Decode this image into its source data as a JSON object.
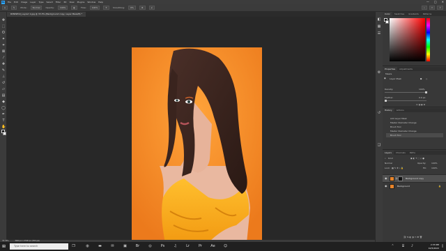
{
  "app": {
    "logo": "Ps",
    "menus": [
      "File",
      "Edit",
      "Image",
      "Layer",
      "Type",
      "Select",
      "Filter",
      "3D",
      "View",
      "Plugins",
      "Window",
      "Help"
    ],
    "window_controls": [
      "—",
      "□",
      "✕"
    ]
  },
  "options": {
    "mode_label": "Mode:",
    "mode_value": "Normal",
    "opacity_label": "Opacity:",
    "opacity_value": "100%",
    "flow_label": "Flow:",
    "flow_value": "100%",
    "smoothing_label": "Smoothing:",
    "smoothing_value": "0%"
  },
  "document": {
    "tab_title": "RVNWP10_Layout 1.jpg @ 33.3% (Background copy, Layer Mask/8) *"
  },
  "status": {
    "zoom": "33.33%",
    "doc_size": "3000 px x 4500 px (300 ppi)"
  },
  "color_panel": {
    "tabs": [
      "Color",
      "Swatches",
      "Gradients",
      "Patterns"
    ]
  },
  "properties_panel": {
    "tabs": [
      "Properties",
      "Adjustments"
    ],
    "section_label": "Masks",
    "mask_label": "Layer Mask",
    "density_label": "Density:",
    "density_value": "100%",
    "feather_label": "Feather:",
    "feather_value": "0.0 px"
  },
  "history_panel": {
    "tabs": [
      "History",
      "Actions"
    ],
    "items": [
      "Add Layer Mask",
      "Master Diameter Change",
      "Brush Tool",
      "Master Diameter Change",
      "Brush Tool"
    ]
  },
  "layers_panel": {
    "tabs": [
      "Layers",
      "Channels",
      "Paths"
    ],
    "kind_label": "Kind",
    "blend_mode": "Normal",
    "opacity_label": "Opacity:",
    "opacity_value": "100%",
    "lock_label": "Lock:",
    "fill_label": "Fill:",
    "fill_value": "100%",
    "layers": [
      {
        "name": "Background copy",
        "selected": true
      },
      {
        "name": "Background",
        "selected": false
      }
    ]
  },
  "taskbar": {
    "search_placeholder": "Type here to search",
    "time": "2:33 PM",
    "date": "10/5/2022"
  }
}
